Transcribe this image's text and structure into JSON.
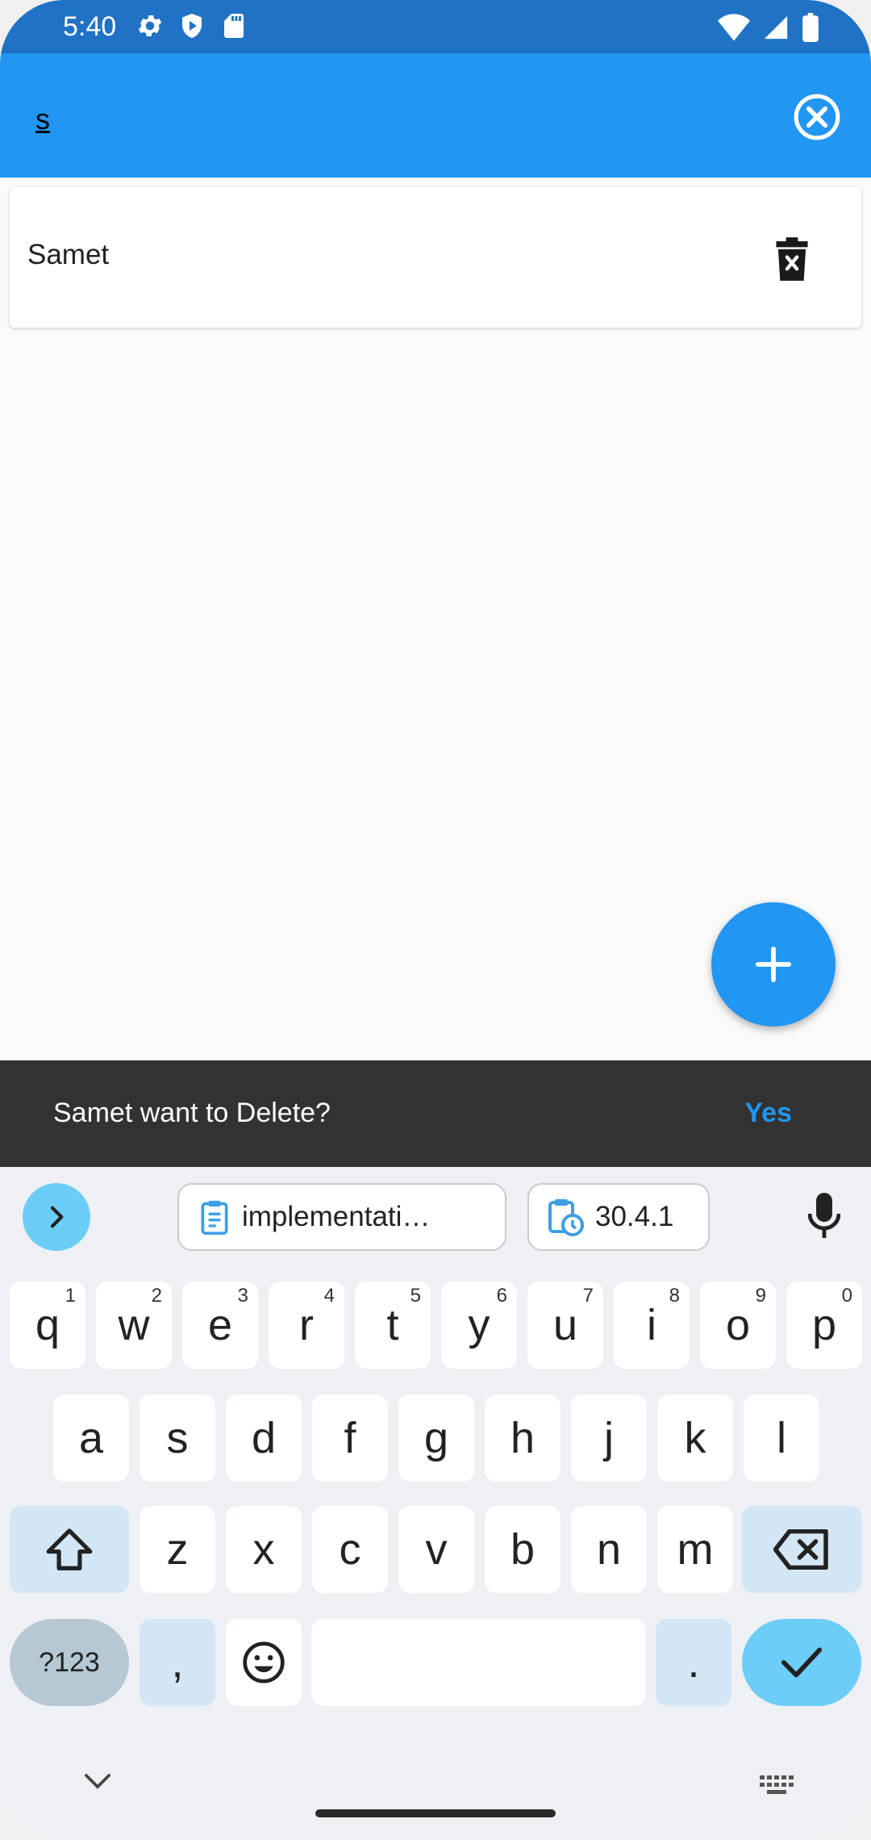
{
  "status_bar": {
    "time": "5:40",
    "left_icons": [
      "gear-icon",
      "shield-play-icon",
      "sd-card-icon"
    ],
    "right_icons": [
      "wifi-icon",
      "signal-icon",
      "battery-icon"
    ]
  },
  "app_bar": {
    "search_value": "s",
    "clear_icon": "close-circle-icon",
    "color": "#2196f3"
  },
  "list": {
    "items": [
      {
        "title": "Samet",
        "action_icon": "delete-icon"
      }
    ]
  },
  "fab": {
    "icon": "plus-icon"
  },
  "snackbar": {
    "message": "Samet want to Delete?",
    "action": "Yes"
  },
  "keyboard": {
    "suggestions": [
      {
        "icon": "clipboard-icon",
        "text": "implementati…"
      },
      {
        "icon": "clipboard-clock-icon",
        "text": "30.4.1"
      }
    ],
    "row1": [
      {
        "k": "q",
        "s": "1"
      },
      {
        "k": "w",
        "s": "2"
      },
      {
        "k": "e",
        "s": "3"
      },
      {
        "k": "r",
        "s": "4"
      },
      {
        "k": "t",
        "s": "5"
      },
      {
        "k": "y",
        "s": "6"
      },
      {
        "k": "u",
        "s": "7"
      },
      {
        "k": "i",
        "s": "8"
      },
      {
        "k": "o",
        "s": "9"
      },
      {
        "k": "p",
        "s": "0"
      }
    ],
    "row2": [
      "a",
      "s",
      "d",
      "f",
      "g",
      "h",
      "j",
      "k",
      "l"
    ],
    "row3": [
      "z",
      "x",
      "c",
      "v",
      "b",
      "n",
      "m"
    ],
    "symbols_label": "?123",
    "comma": ",",
    "period": "."
  }
}
